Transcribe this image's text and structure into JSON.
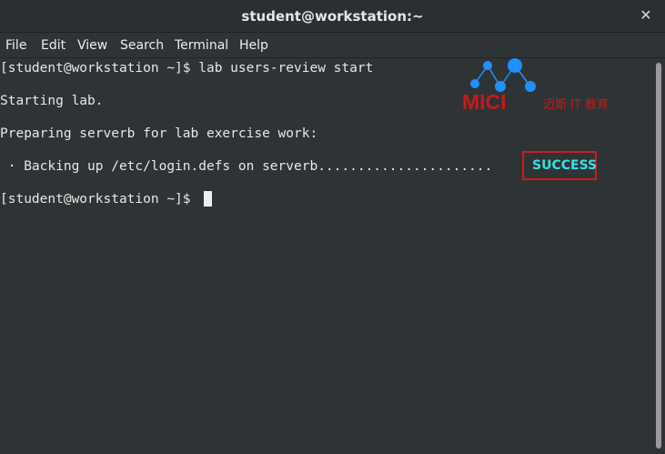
{
  "window": {
    "title": "student@workstation:~",
    "close_glyph": "✕"
  },
  "menu": {
    "items": [
      "File",
      "Edit",
      "View",
      "Search",
      "Terminal",
      "Help"
    ]
  },
  "terminal": {
    "lines": [
      "[student@workstation ~]$ lab users-review start",
      "Starting lab.",
      "Preparing serverb for lab exercise work:",
      " · Backing up /etc/login.defs on serverb......................",
      "[student@workstation ~]$ "
    ],
    "status": "SUCCESS"
  },
  "watermark": {
    "brand": "MICI",
    "tagline": "迈斯 IT 教育"
  },
  "colors": {
    "background": "#2e3436",
    "success": "#34e2e2",
    "highlight_border": "#d0191d",
    "logo_blue": "#1e90ff",
    "logo_red": "#c41a1a"
  }
}
